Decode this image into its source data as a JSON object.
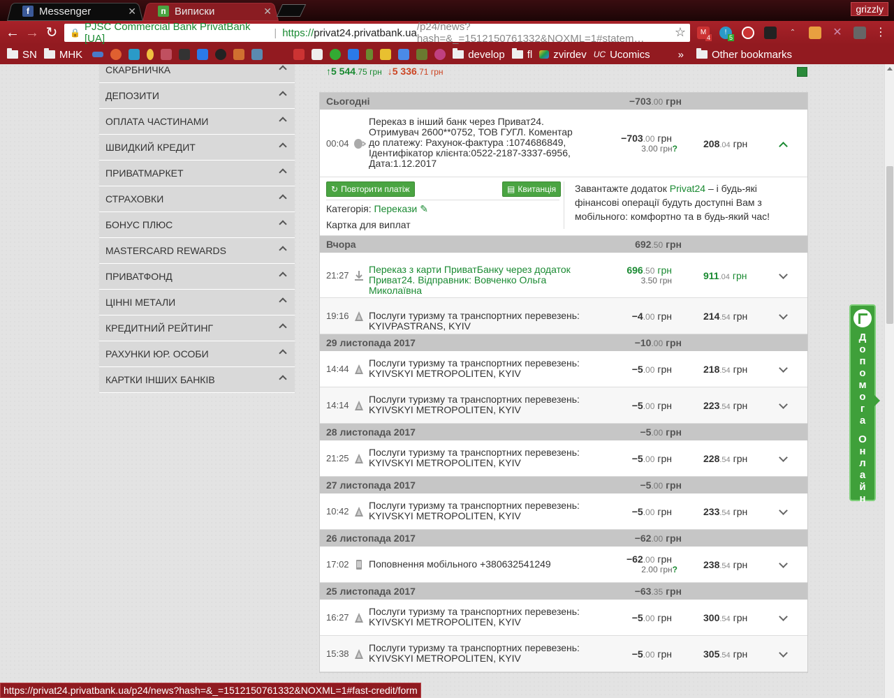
{
  "browser": {
    "tabs": [
      {
        "title": "Messenger",
        "favicon": "facebook-icon",
        "active": false
      },
      {
        "title": "Виписки",
        "favicon": "privat-icon",
        "active": true
      }
    ],
    "profile": "grizzly",
    "omnibox": {
      "ev_label": "PJSC Commercial Bank PrivatBank [UA]",
      "url_scheme": "https://",
      "url_host": "privat24.privatbank.ua",
      "url_path": "/p24/news?hash=&_=1512150761332&NOXML=1#statem…"
    },
    "bookmarks": [
      "SN",
      "MHK",
      "develop",
      "fl",
      "zvirdev",
      "Ucomics",
      "Other bookmarks"
    ],
    "ext_badges": [
      "4",
      "5"
    ],
    "overflow_label": "»"
  },
  "sidebar": {
    "items": [
      "СКАРБНИЧКА",
      "ДЕПОЗИТИ",
      "ОПЛАТА ЧАСТИНАМИ",
      "ШВИДКИЙ КРЕДИТ",
      "ПРИВАТМАРКЕТ",
      "СТРАХОВКИ",
      "БОНУС ПЛЮС",
      "MASTERCARD REWARDS",
      "ПРИВАТФОНД",
      "ЦІННІ МЕТАЛИ",
      "КРЕДИТНИЙ РЕЙТИНГ",
      "РАХУНКИ ЮР. ОСОБИ",
      "КАРТКИ ІНШИХ БАНКІВ"
    ]
  },
  "balance": {
    "in_main": "5 544",
    "in_frac": ".75",
    "in_unit": " грн",
    "out_main": "5 336",
    "out_frac": ".71",
    "out_unit": " грн"
  },
  "days": [
    {
      "label": "Сьогодні",
      "total_main": "−703",
      "total_frac": ".00",
      "rows": [
        {
          "time": "00:04",
          "icon": "coins-icon",
          "desc": "Переказ в інший банк через Приват24. Отримувач 2600**0752, ТОВ ГУГЛ. Коментар до платежу: Рахунок-фактура :1074686849, Ідентифікатор клієнта:0522-2187-3337-6956, Дата:1.12.2017",
          "amt_main": "−703",
          "amt_frac": ".00",
          "fee": "3.00 грн",
          "bal_main": "208",
          "bal_frac": ".04",
          "expanded": true
        }
      ]
    },
    {
      "label": "Вчора",
      "total_main": "692",
      "total_frac": ".50",
      "rows": [
        {
          "time": "21:27",
          "icon": "download-icon",
          "desc": "Переказ з карти ПриватБанку через додаток Приват24. Відправник: Вовченко Ольга Миколаївна",
          "amt_main": "696",
          "amt_frac": ".50",
          "fee": "3.50 грн",
          "bal_main": "911",
          "bal_frac": ".04",
          "green": true
        },
        {
          "time": "19:16",
          "icon": "transport-icon",
          "desc": "Послуги туризму та транспортних перевезень: KYIVPASTRANS, KYIV",
          "amt_main": "−4",
          "amt_frac": ".00",
          "bal_main": "214",
          "bal_frac": ".54"
        }
      ]
    },
    {
      "label": "29 листопада 2017",
      "total_main": "−10",
      "total_frac": ".00",
      "rows": [
        {
          "time": "14:44",
          "icon": "transport-icon",
          "desc": "Послуги туризму та транспортних перевезень: KYIVSKYI METROPOLITEN, KYIV",
          "amt_main": "−5",
          "amt_frac": ".00",
          "bal_main": "218",
          "bal_frac": ".54"
        },
        {
          "time": "14:14",
          "icon": "transport-icon",
          "desc": "Послуги туризму та транспортних перевезень: KYIVSKYI METROPOLITEN, KYIV",
          "amt_main": "−5",
          "amt_frac": ".00",
          "bal_main": "223",
          "bal_frac": ".54"
        }
      ]
    },
    {
      "label": "28 листопада 2017",
      "total_main": "−5",
      "total_frac": ".00",
      "rows": [
        {
          "time": "21:25",
          "icon": "transport-icon",
          "desc": "Послуги туризму та транспортних перевезень: KYIVSKYI METROPOLITEN, KYIV",
          "amt_main": "−5",
          "amt_frac": ".00",
          "bal_main": "228",
          "bal_frac": ".54"
        }
      ]
    },
    {
      "label": "27 листопада 2017",
      "total_main": "−5",
      "total_frac": ".00",
      "rows": [
        {
          "time": "10:42",
          "icon": "transport-icon",
          "desc": "Послуги туризму та транспортних перевезень: KYIVSKYI METROPOLITEN, KYIV",
          "amt_main": "−5",
          "amt_frac": ".00",
          "bal_main": "233",
          "bal_frac": ".54"
        }
      ]
    },
    {
      "label": "26 листопада 2017",
      "total_main": "−62",
      "total_frac": ".00",
      "rows": [
        {
          "time": "17:02",
          "icon": "mobile-icon",
          "desc": "Поповнення мобільного +380632541249",
          "amt_main": "−62",
          "amt_frac": ".00",
          "fee": "2.00 грн",
          "bal_main": "238",
          "bal_frac": ".54"
        }
      ]
    },
    {
      "label": "25 листопада 2017",
      "total_main": "−63",
      "total_frac": ".35",
      "rows": [
        {
          "time": "16:27",
          "icon": "transport-icon",
          "desc": "Послуги туризму та транспортних перевезень: KYIVSKYI METROPOLITEN, KYIV",
          "amt_main": "−5",
          "amt_frac": ".00",
          "bal_main": "300",
          "bal_frac": ".54"
        },
        {
          "time": "15:38",
          "icon": "transport-icon",
          "desc": "Послуги туризму та транспортних перевезень: KYIVSKYI METROPOLITEN, KYIV",
          "amt_main": "−5",
          "amt_frac": ".00",
          "bal_main": "305",
          "bal_frac": ".54"
        }
      ]
    }
  ],
  "currency": "грн",
  "detail": {
    "repeat_label": "Повторити платіж",
    "receipt_label": "Квитанція",
    "category_label": "Категорія:",
    "category_value": "Перекази",
    "card_label": "Картка для виплат",
    "promo_before": "Завантажте додаток ",
    "promo_link": "Privat24",
    "promo_after": " – і будь-які фінансові операції будуть доступні Вам з мобільного: комфортно та в будь-який час!"
  },
  "help_tab": {
    "label_line1": "Допомога",
    "label_line2": "Онлайн"
  },
  "status_url": "https://privat24.privatbank.ua/p24/news?hash=&_=1512150761332&NOXML=1#fast-credit/form",
  "colors": {
    "brand_green": "#1a8a32",
    "chrome_red": "#9b1d23"
  }
}
